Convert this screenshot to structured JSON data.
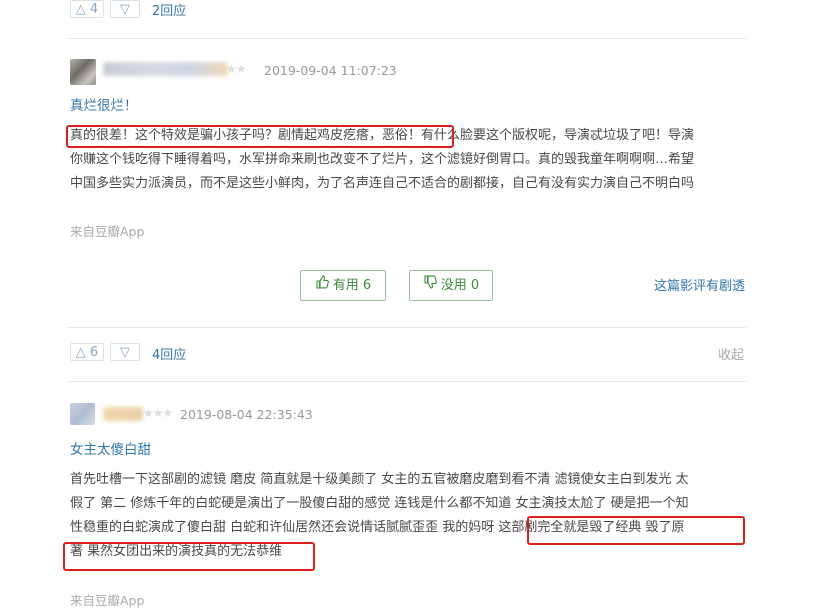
{
  "top_bar": {
    "up_count": "4",
    "reply_label": "2回应"
  },
  "review1": {
    "date": "2019-09-04 11:07:23",
    "title": "真烂很烂！",
    "lines": [
      "真的很差！这个特效是骗小孩子吗？剧情起鸡皮疙瘩，恶俗！有什么脸要这个版权呢，导演忒垃圾了吧！导演",
      "你赚这个钱吃得下睡得着吗，水军拼命来刷也改变不了烂片，这个滤镜好倒胃口。真的毁我童年啊啊啊…希望",
      "中国多些实力派演员，而不是这些小鲜肉，为了名声连自己不适合的剧都接，自己有没有实力演自己不明白吗"
    ],
    "source": "来自豆瓣App",
    "useful_label": "有用 6",
    "useless_label": "没用 0",
    "spoiler_label": "这篇影评有剧透",
    "up_count": "6",
    "reply_label": "4回应",
    "collapse_label": "收起"
  },
  "review2": {
    "date": "2019-08-04 22:35:43",
    "title": "女主太傻白甜",
    "lines": [
      "首先吐槽一下这部剧的滤镜 磨皮 简直就是十级美颜了 女主的五官被磨皮磨到看不清 滤镜使女主白到发光 太",
      "假了 第二 修炼千年的白蛇硬是演出了一股傻白甜的感觉 连钱是什么都不知道 女主演技太尬了 硬是把一个知",
      "性稳重的白蛇演成了傻白甜 白蛇和许仙居然还会说情话腻腻歪歪 我的妈呀 这部剧完全就是毁了经典 毁了原",
      "著 果然女团出来的演技真的无法恭维"
    ],
    "source": "来自豆瓣App"
  },
  "icons": {
    "up": "triangle-up-icon",
    "down": "triangle-down-icon",
    "thumb_up": "thumbs-up-icon",
    "thumb_down": "thumbs-down-icon"
  },
  "colors": {
    "link": "#3377aa",
    "highlight": "#d9201c",
    "button_text": "#3a8a3a"
  }
}
